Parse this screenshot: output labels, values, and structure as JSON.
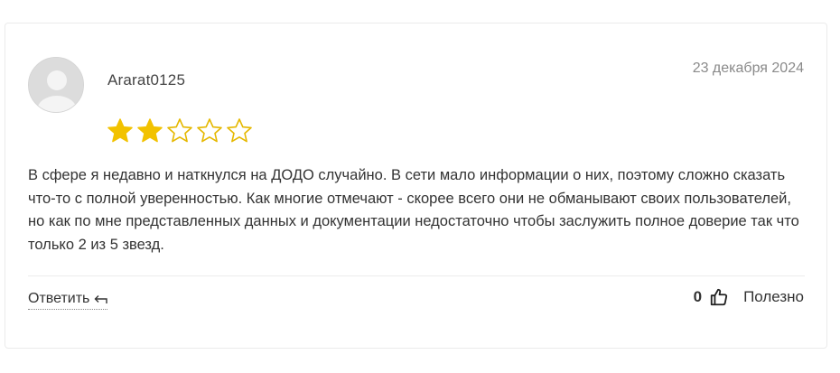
{
  "review": {
    "username": "Ararat0125",
    "date": "23 декабря 2024",
    "rating": 2,
    "rating_max": 5,
    "text": "В сфере я недавно и наткнулся на ДОДО случайно. В сети мало информации о них, поэтому сложно сказать что-то с полной уверенностью. Как многие отмечают - скорее всего они не обманывают своих пользователей, но как по мне представленных данных и документации недостаточно чтобы заслужить полное доверие так что только 2 из 5 звезд.",
    "reply_label": "Ответить",
    "helpful_count": "0",
    "helpful_label": "Полезно"
  },
  "colors": {
    "star_filled": "#f2c200",
    "star_outline": "#e5b800",
    "text": "#333333",
    "date": "#8a8a8a"
  },
  "icons": {
    "avatar": "user-placeholder-icon",
    "star": "star-icon",
    "reply": "reply-arrow-icon",
    "helpful": "thumbs-up-icon"
  }
}
